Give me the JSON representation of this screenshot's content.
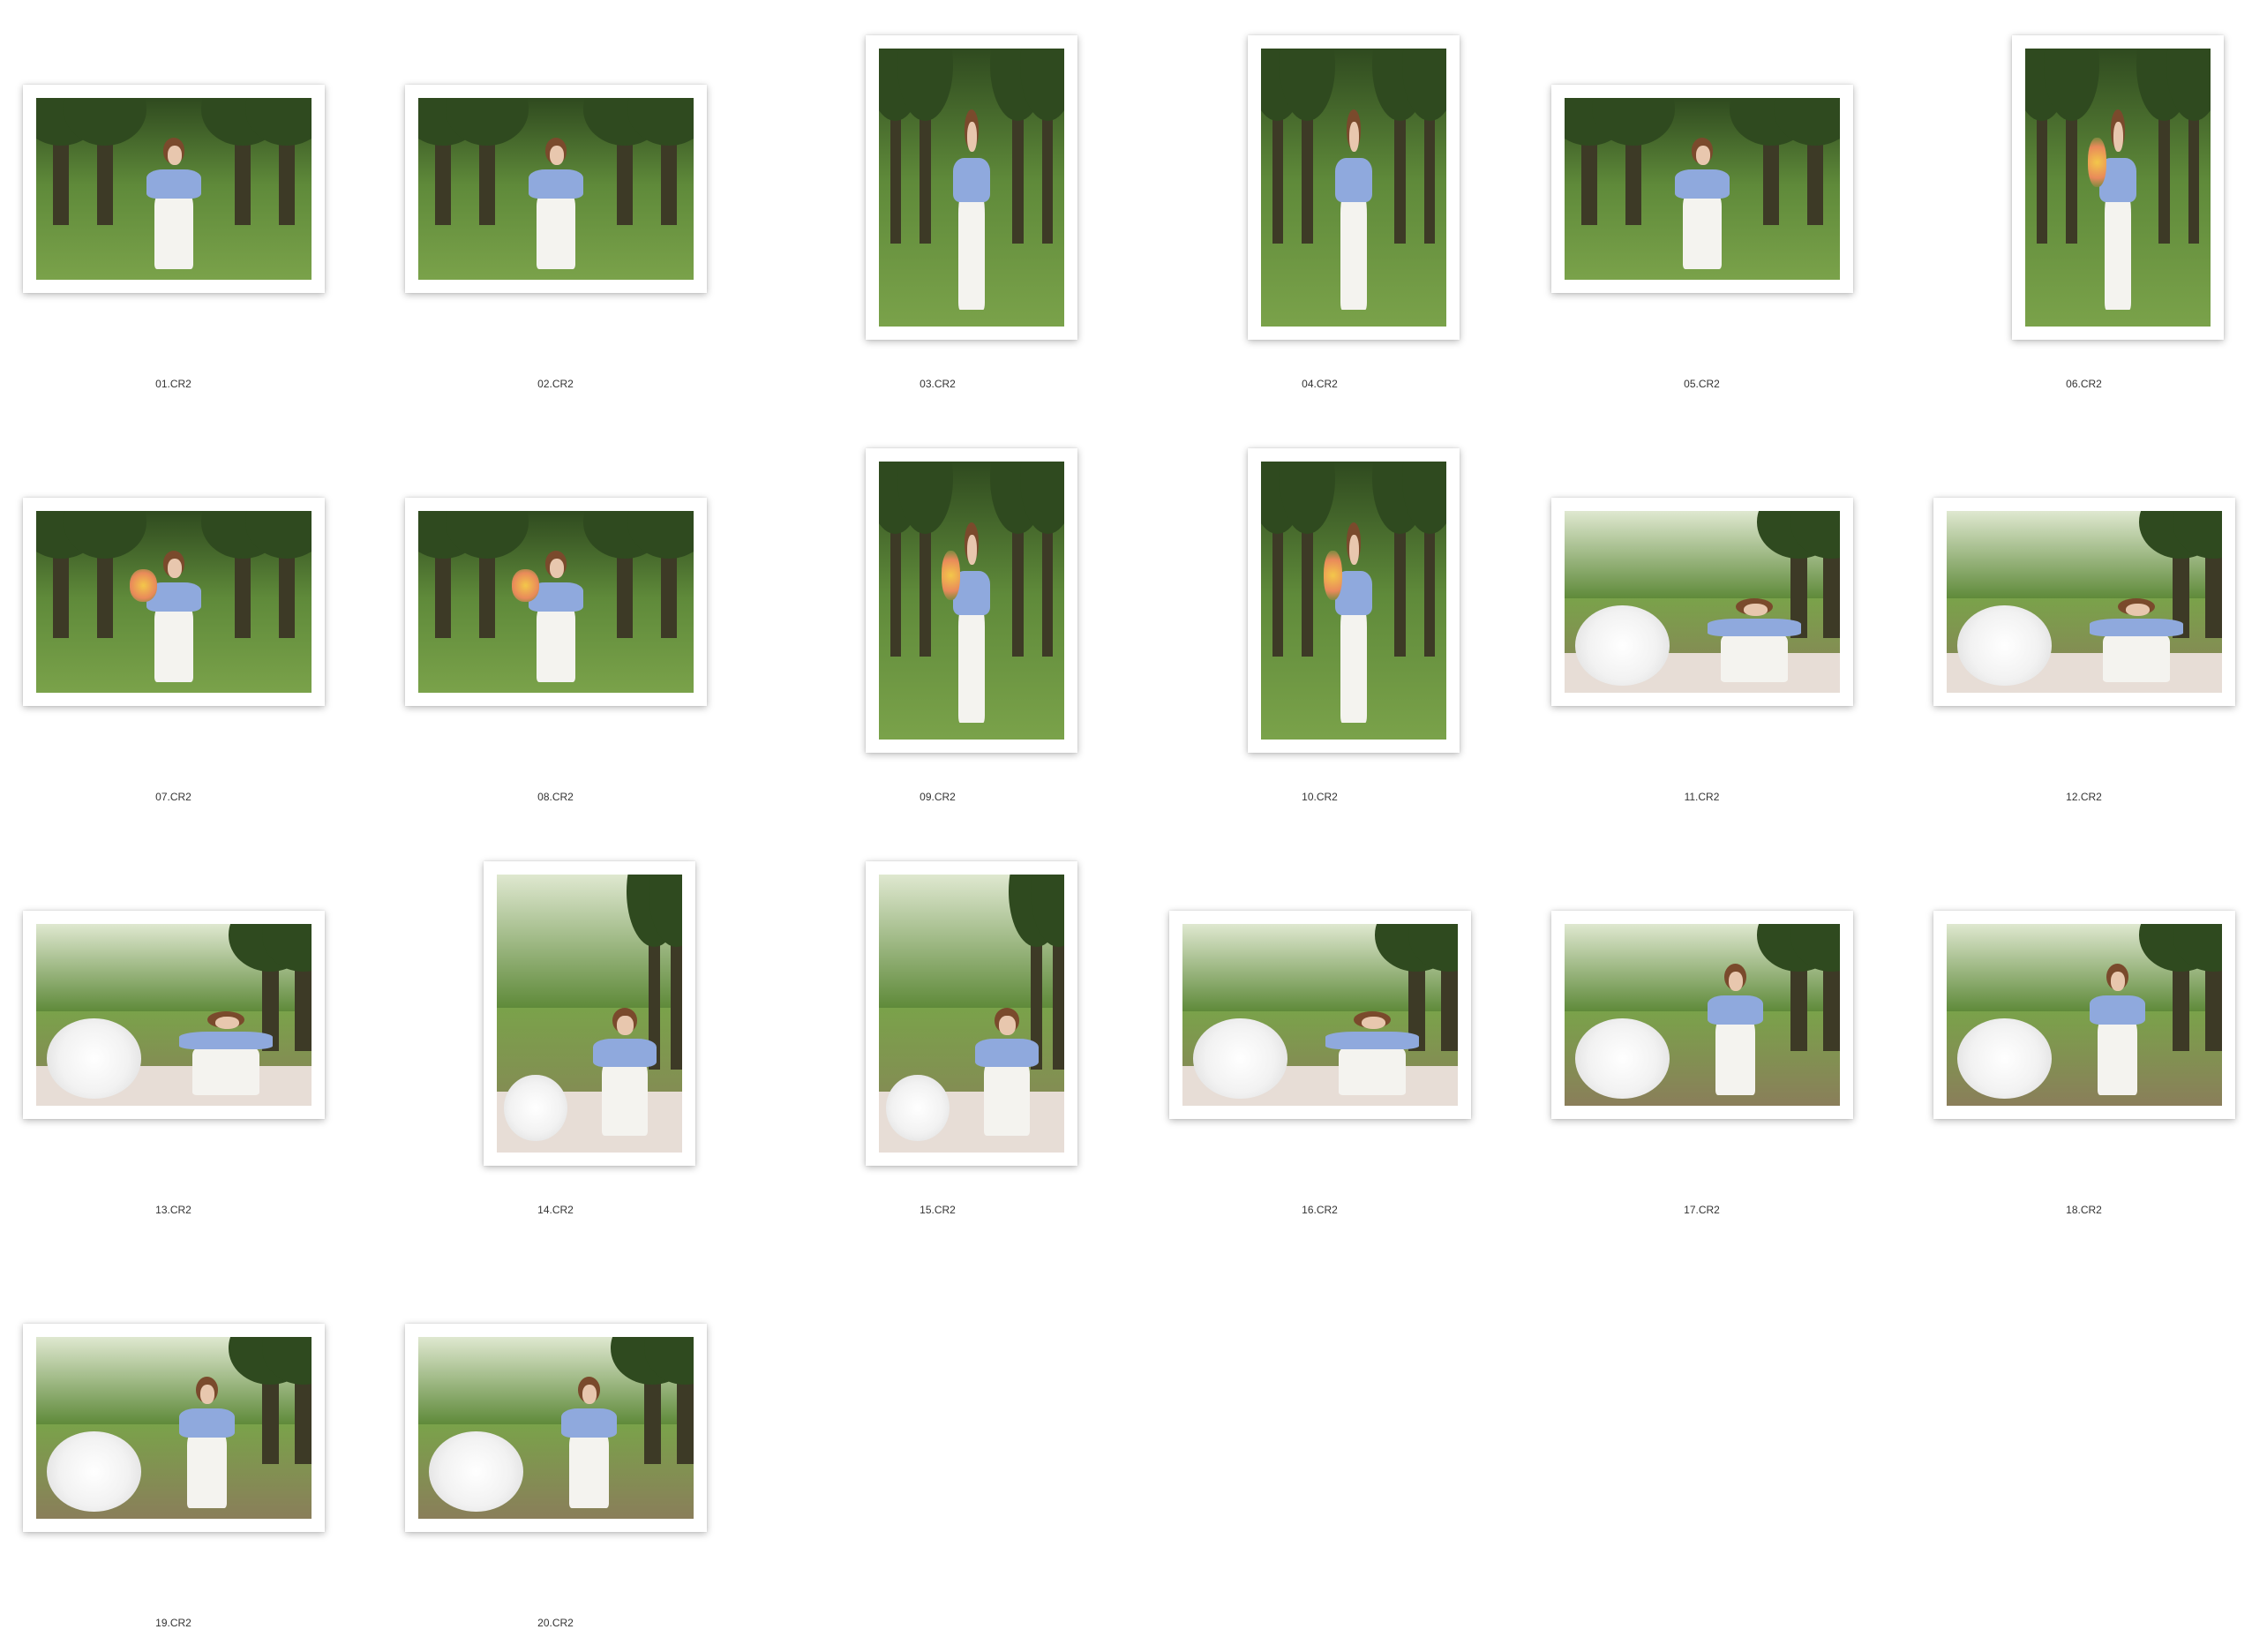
{
  "items": [
    {
      "filename": "01.CR2",
      "orientation": "landscape",
      "scene": "forest",
      "accessory": "none"
    },
    {
      "filename": "02.CR2",
      "orientation": "landscape",
      "scene": "forest",
      "accessory": "none"
    },
    {
      "filename": "03.CR2",
      "orientation": "portrait",
      "scene": "forest",
      "accessory": "none"
    },
    {
      "filename": "04.CR2",
      "orientation": "portrait",
      "scene": "forest",
      "accessory": "none"
    },
    {
      "filename": "05.CR2",
      "orientation": "landscape",
      "scene": "forest",
      "accessory": "none"
    },
    {
      "filename": "06.CR2",
      "orientation": "portrait",
      "scene": "forest",
      "accessory": "bouquet"
    },
    {
      "filename": "07.CR2",
      "orientation": "landscape",
      "scene": "forest",
      "accessory": "bouquet"
    },
    {
      "filename": "08.CR2",
      "orientation": "landscape",
      "scene": "forest",
      "accessory": "bouquet"
    },
    {
      "filename": "09.CR2",
      "orientation": "portrait",
      "scene": "forest",
      "accessory": "bouquet"
    },
    {
      "filename": "10.CR2",
      "orientation": "portrait",
      "scene": "forest",
      "accessory": "bouquet"
    },
    {
      "filename": "11.CR2",
      "orientation": "landscape",
      "scene": "picnic",
      "accessory": "umbrella"
    },
    {
      "filename": "12.CR2",
      "orientation": "landscape",
      "scene": "picnic",
      "accessory": "umbrella"
    },
    {
      "filename": "13.CR2",
      "orientation": "landscape",
      "scene": "picnic",
      "accessory": "umbrella"
    },
    {
      "filename": "14.CR2",
      "orientation": "portrait",
      "scene": "picnic",
      "accessory": "umbrella"
    },
    {
      "filename": "15.CR2",
      "orientation": "portrait",
      "scene": "picnic",
      "accessory": "umbrella"
    },
    {
      "filename": "16.CR2",
      "orientation": "landscape",
      "scene": "picnic",
      "accessory": "umbrella"
    },
    {
      "filename": "17.CR2",
      "orientation": "landscape",
      "scene": "meadow",
      "accessory": "umbrella"
    },
    {
      "filename": "18.CR2",
      "orientation": "landscape",
      "scene": "meadow",
      "accessory": "umbrella"
    },
    {
      "filename": "19.CR2",
      "orientation": "landscape",
      "scene": "meadow",
      "accessory": "umbrella"
    },
    {
      "filename": "20.CR2",
      "orientation": "landscape",
      "scene": "meadow",
      "accessory": "umbrella"
    }
  ],
  "colors": {
    "background": "#ffffff",
    "foliage": "#2f4a1f",
    "foliage_light": "#5f8a3a",
    "grass": "#7aa24a",
    "sky": "#dfe8d0"
  }
}
